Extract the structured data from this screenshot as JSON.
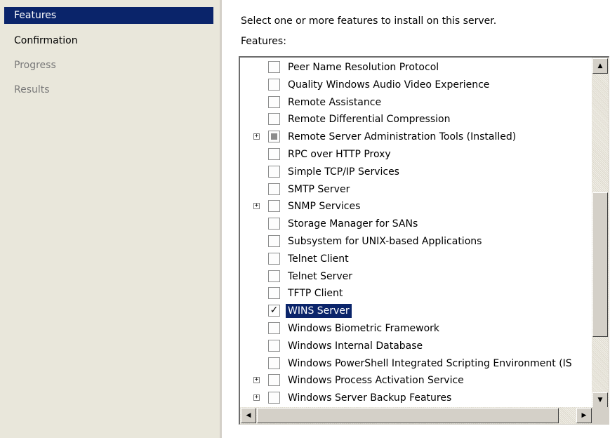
{
  "nav": {
    "items": [
      {
        "label": "Features",
        "state": "active"
      },
      {
        "label": "Confirmation",
        "state": "normal"
      },
      {
        "label": "Progress",
        "state": "disabled"
      },
      {
        "label": "Results",
        "state": "disabled"
      }
    ]
  },
  "main": {
    "instruction": "Select one or more features to install on this server.",
    "features_label": "Features:"
  },
  "features": [
    {
      "label": "Peer Name Resolution Protocol",
      "expandable": false,
      "state": "unchecked"
    },
    {
      "label": "Quality Windows Audio Video Experience",
      "expandable": false,
      "state": "unchecked"
    },
    {
      "label": "Remote Assistance",
      "expandable": false,
      "state": "unchecked"
    },
    {
      "label": "Remote Differential Compression",
      "expandable": false,
      "state": "unchecked"
    },
    {
      "label": "Remote Server Administration Tools  (Installed)",
      "expandable": true,
      "state": "indeterminate"
    },
    {
      "label": "RPC over HTTP Proxy",
      "expandable": false,
      "state": "unchecked"
    },
    {
      "label": "Simple TCP/IP Services",
      "expandable": false,
      "state": "unchecked"
    },
    {
      "label": "SMTP Server",
      "expandable": false,
      "state": "unchecked"
    },
    {
      "label": "SNMP Services",
      "expandable": true,
      "state": "unchecked"
    },
    {
      "label": "Storage Manager for SANs",
      "expandable": false,
      "state": "unchecked"
    },
    {
      "label": "Subsystem for UNIX-based Applications",
      "expandable": false,
      "state": "unchecked"
    },
    {
      "label": "Telnet Client",
      "expandable": false,
      "state": "unchecked"
    },
    {
      "label": "Telnet Server",
      "expandable": false,
      "state": "unchecked"
    },
    {
      "label": "TFTP Client",
      "expandable": false,
      "state": "unchecked"
    },
    {
      "label": "WINS Server",
      "expandable": false,
      "state": "checked",
      "selected": true
    },
    {
      "label": "Windows Biometric Framework",
      "expandable": false,
      "state": "unchecked"
    },
    {
      "label": "Windows Internal Database",
      "expandable": false,
      "state": "unchecked"
    },
    {
      "label": "Windows PowerShell Integrated Scripting Environment (IS",
      "expandable": false,
      "state": "unchecked"
    },
    {
      "label": "Windows Process Activation Service",
      "expandable": true,
      "state": "unchecked"
    },
    {
      "label": "Windows Server Backup Features",
      "expandable": true,
      "state": "unchecked"
    }
  ],
  "icons": {
    "scroll_up": "scroll-up-arrow-icon",
    "scroll_down": "scroll-down-arrow-icon",
    "scroll_left": "scroll-left-arrow-icon",
    "scroll_right": "scroll-right-arrow-icon",
    "expand": "plus-expand-icon",
    "check": "checkmark-icon"
  },
  "colors": {
    "selection": "#0a246a",
    "nav_background": "#e9e7db"
  }
}
